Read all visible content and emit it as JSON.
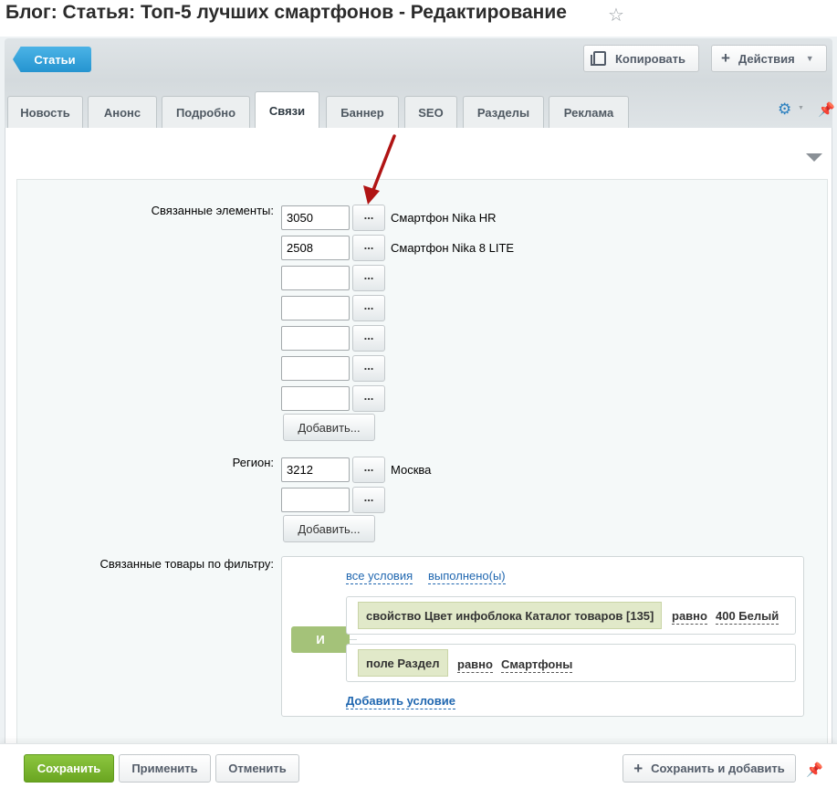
{
  "page": {
    "title": "Блог: Статья: Топ-5 лучших смартфонов - Редактирование"
  },
  "toolbar": {
    "back_label": "Статьи",
    "copy_label": "Копировать",
    "actions_label": "Действия"
  },
  "tabs": [
    {
      "label": "Новость"
    },
    {
      "label": "Анонс"
    },
    {
      "label": "Подробно"
    },
    {
      "label": "Связи",
      "active": true
    },
    {
      "label": "Баннер"
    },
    {
      "label": "SEO"
    },
    {
      "label": "Разделы"
    },
    {
      "label": "Реклама"
    }
  ],
  "related": {
    "label": "Связанные элементы:",
    "dots_label": "...",
    "rows": [
      {
        "value": "3050",
        "name": "Смартфон Nika HR"
      },
      {
        "value": "2508",
        "name": "Смартфон Nika 8 LITE"
      },
      {
        "value": "",
        "name": ""
      },
      {
        "value": "",
        "name": ""
      },
      {
        "value": "",
        "name": ""
      },
      {
        "value": "",
        "name": ""
      },
      {
        "value": "",
        "name": ""
      }
    ],
    "add_label": "Добавить..."
  },
  "region": {
    "label": "Регион:",
    "dots_label": "...",
    "rows": [
      {
        "value": "3212",
        "name": "Москва"
      },
      {
        "value": "",
        "name": ""
      }
    ],
    "add_label": "Добавить..."
  },
  "filter": {
    "label": "Связанные товары по фильтру:",
    "all_conditions": "все условия",
    "fulfilled": "выполнено(ы)",
    "and_label": "И",
    "conditions": [
      {
        "property": "свойство Цвет инфоблока Каталог товаров [135]",
        "operator": "равно",
        "value": "400 Белый"
      },
      {
        "property": "поле Раздел",
        "operator": "равно",
        "value": "Смартфоны"
      }
    ],
    "add_condition": "Добавить условие"
  },
  "footer": {
    "save_label": "Сохранить",
    "apply_label": "Применить",
    "cancel_label": "Отменить",
    "save_add_label": "Сохранить и добавить"
  },
  "colors": {
    "accent": "#2594d0",
    "save": "#6aa521",
    "arrow": "#b01414",
    "condition": "#e1e9c9",
    "and_badge": "#a4c279"
  }
}
